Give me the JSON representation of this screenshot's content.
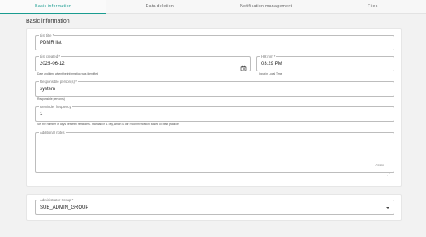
{
  "tabs": [
    {
      "label": "Basic information",
      "active": true
    },
    {
      "label": "Data deletion",
      "active": false
    },
    {
      "label": "Notification management",
      "active": false
    },
    {
      "label": "Files",
      "active": false
    }
  ],
  "section_title": "Basic information",
  "form": {
    "list_title": {
      "label": "List title",
      "required": "*",
      "value": "PDMR list"
    },
    "list_created": {
      "label": "List created",
      "required": "*",
      "value": "2025-06-12",
      "helper": "Date and time when the information was identified"
    },
    "hh_mm": {
      "label": "HH:mm",
      "required": "*",
      "value": "03:29 PM",
      "helper": "Input in Local Time"
    },
    "responsible": {
      "label": "Responsible person(s)",
      "required": "*",
      "value": "system",
      "helper": "Responsible person(s)"
    },
    "reminder": {
      "label": "Reminder frequency",
      "value": "1",
      "helper": "Set the number of days between reminders. Standard is 1 day, which is our recommendation based on best practice."
    },
    "notes": {
      "label": "Additional notes",
      "value": "",
      "counter": "0/1500"
    },
    "admin_group": {
      "label": "Administrator Group",
      "required": "*",
      "value": "SUB_ADMIN_GROUP"
    }
  },
  "icons": {
    "calendar": "calendar-icon",
    "dropdown": "chevron-down-icon",
    "resize": "resize-handle-icon"
  },
  "colors": {
    "accent": "#1a9c90",
    "background": "#f2f2f2",
    "border": "#bdbdbd"
  }
}
